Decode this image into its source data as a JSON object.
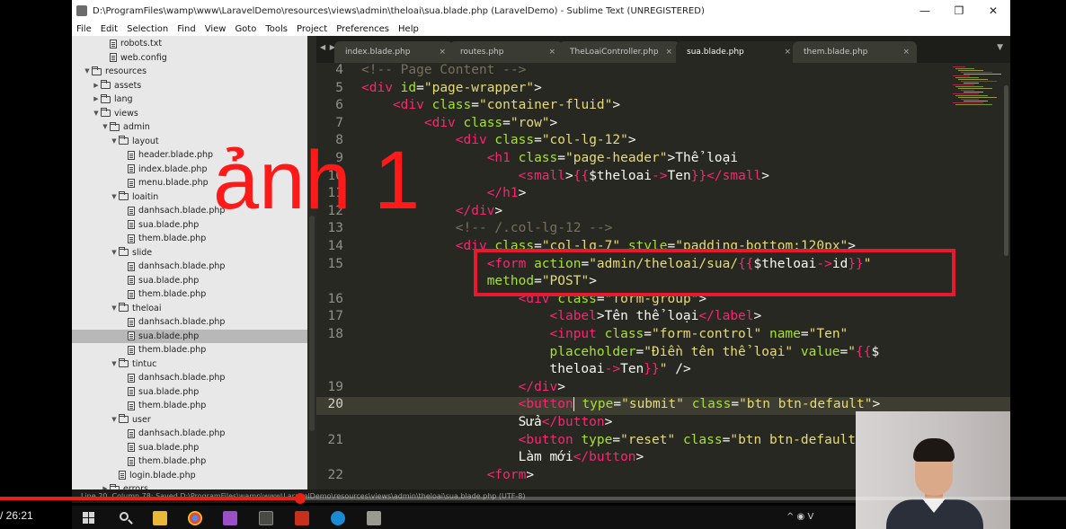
{
  "window": {
    "title": "D:\\ProgramFiles\\wamp\\www\\LaravelDemo\\resources\\views\\admin\\theloai\\sua.blade.php (LaravelDemo) - Sublime Text (UNREGISTERED)",
    "minimize": "—",
    "maximize": "❐",
    "close": "✕"
  },
  "menu": [
    "File",
    "Edit",
    "Selection",
    "Find",
    "View",
    "Goto",
    "Tools",
    "Project",
    "Preferences",
    "Help"
  ],
  "sidebar": {
    "items": [
      {
        "label": "robots.txt",
        "type": "file",
        "depth": 3
      },
      {
        "label": "web.config",
        "type": "file",
        "depth": 3
      },
      {
        "label": "resources",
        "type": "folder",
        "depth": 1,
        "open": true
      },
      {
        "label": "assets",
        "type": "folder",
        "depth": 2,
        "open": false
      },
      {
        "label": "lang",
        "type": "folder",
        "depth": 2,
        "open": false
      },
      {
        "label": "views",
        "type": "folder",
        "depth": 2,
        "open": true
      },
      {
        "label": "admin",
        "type": "folder",
        "depth": 3,
        "open": true
      },
      {
        "label": "layout",
        "type": "folder",
        "depth": 4,
        "open": true
      },
      {
        "label": "header.blade.php",
        "type": "file",
        "depth": 5
      },
      {
        "label": "index.blade.php",
        "type": "file",
        "depth": 5
      },
      {
        "label": "menu.blade.php",
        "type": "file",
        "depth": 5
      },
      {
        "label": "loaitin",
        "type": "folder",
        "depth": 4,
        "open": true
      },
      {
        "label": "danhsach.blade.php",
        "type": "file",
        "depth": 5
      },
      {
        "label": "sua.blade.php",
        "type": "file",
        "depth": 5
      },
      {
        "label": "them.blade.php",
        "type": "file",
        "depth": 5
      },
      {
        "label": "slide",
        "type": "folder",
        "depth": 4,
        "open": true
      },
      {
        "label": "danhsach.blade.php",
        "type": "file",
        "depth": 5
      },
      {
        "label": "sua.blade.php",
        "type": "file",
        "depth": 5
      },
      {
        "label": "them.blade.php",
        "type": "file",
        "depth": 5
      },
      {
        "label": "theloai",
        "type": "folder",
        "depth": 4,
        "open": true
      },
      {
        "label": "danhsach.blade.php",
        "type": "file",
        "depth": 5
      },
      {
        "label": "sua.blade.php",
        "type": "file",
        "depth": 5,
        "selected": true
      },
      {
        "label": "them.blade.php",
        "type": "file",
        "depth": 5
      },
      {
        "label": "tintuc",
        "type": "folder",
        "depth": 4,
        "open": true
      },
      {
        "label": "danhsach.blade.php",
        "type": "file",
        "depth": 5
      },
      {
        "label": "sua.blade.php",
        "type": "file",
        "depth": 5
      },
      {
        "label": "them.blade.php",
        "type": "file",
        "depth": 5
      },
      {
        "label": "user",
        "type": "folder",
        "depth": 4,
        "open": true
      },
      {
        "label": "danhsach.blade.php",
        "type": "file",
        "depth": 5
      },
      {
        "label": "sua.blade.php",
        "type": "file",
        "depth": 5
      },
      {
        "label": "them.blade.php",
        "type": "file",
        "depth": 5
      },
      {
        "label": "login.blade.php",
        "type": "file",
        "depth": 4
      },
      {
        "label": "errors",
        "type": "folder",
        "depth": 3,
        "open": false
      }
    ]
  },
  "tabs": [
    {
      "label": "index.blade.php",
      "active": false
    },
    {
      "label": "routes.php",
      "active": false
    },
    {
      "label": "TheLoaiController.php",
      "active": false
    },
    {
      "label": "sua.blade.php",
      "active": true
    },
    {
      "label": "them.blade.php",
      "active": false
    }
  ],
  "tab_close": "×",
  "tab_arrows": "◀ ▶",
  "tab_dropdown": "▼",
  "editor": {
    "line_numbers": [
      "4",
      "5",
      "6",
      "7",
      "8",
      "9",
      "10",
      "11",
      "12",
      "13",
      "14",
      "15",
      "",
      "16",
      "17",
      "18",
      "",
      "",
      "19",
      "20",
      "",
      "21",
      "",
      "22"
    ],
    "current_line": "20",
    "code": [
      [
        [
          "c",
          "<!-- Page Content -->"
        ]
      ],
      [
        [
          "t",
          "<div "
        ],
        [
          "a",
          "id"
        ],
        [
          "x",
          "="
        ],
        [
          "s",
          "\"page-wrapper\""
        ],
        [
          "x",
          ">"
        ]
      ],
      [
        [
          "x",
          "    "
        ],
        [
          "t",
          "<div "
        ],
        [
          "a",
          "class"
        ],
        [
          "x",
          "="
        ],
        [
          "s",
          "\"container-fluid\""
        ],
        [
          "x",
          ">"
        ]
      ],
      [
        [
          "x",
          "        "
        ],
        [
          "t",
          "<div "
        ],
        [
          "a",
          "class"
        ],
        [
          "x",
          "="
        ],
        [
          "s",
          "\"row\""
        ],
        [
          "x",
          ">"
        ]
      ],
      [
        [
          "x",
          "            "
        ],
        [
          "t",
          "<div "
        ],
        [
          "a",
          "class"
        ],
        [
          "x",
          "="
        ],
        [
          "s",
          "\"col-lg-12\""
        ],
        [
          "x",
          ">"
        ]
      ],
      [
        [
          "x",
          "                "
        ],
        [
          "t",
          "<h1 "
        ],
        [
          "a",
          "class"
        ],
        [
          "x",
          "="
        ],
        [
          "s",
          "\"page-header\""
        ],
        [
          "x",
          ">Thể loại"
        ]
      ],
      [
        [
          "x",
          "                    "
        ],
        [
          "t",
          "<small"
        ],
        [
          "x",
          ">"
        ],
        [
          "p",
          "{{"
        ],
        [
          "x",
          "$theloai"
        ],
        [
          "p",
          "->"
        ],
        [
          "x",
          "Ten"
        ],
        [
          "p",
          "}}"
        ],
        [
          "t",
          "</small"
        ],
        [
          "x",
          ">"
        ]
      ],
      [
        [
          "x",
          "                "
        ],
        [
          "t",
          "</h1"
        ],
        [
          "x",
          ">"
        ]
      ],
      [
        [
          "x",
          "            "
        ],
        [
          "t",
          "</div"
        ],
        [
          "x",
          ">"
        ]
      ],
      [
        [
          "x",
          "            "
        ],
        [
          "c",
          "<!-- /.col-lg-12 -->"
        ]
      ],
      [
        [
          "x",
          "            "
        ],
        [
          "t",
          "<div "
        ],
        [
          "a",
          "class"
        ],
        [
          "x",
          "="
        ],
        [
          "s",
          "\"col-lg-7\" "
        ],
        [
          "a",
          "style"
        ],
        [
          "x",
          "="
        ],
        [
          "s",
          "\"padding-bottom:120px\""
        ],
        [
          "x",
          ">"
        ]
      ],
      [
        [
          "x",
          "                "
        ],
        [
          "t",
          "<form "
        ],
        [
          "a",
          "action"
        ],
        [
          "x",
          "="
        ],
        [
          "s",
          "\"admin/theloai/sua/"
        ],
        [
          "p",
          "{{"
        ],
        [
          "x",
          "$theloai"
        ],
        [
          "p",
          "->"
        ],
        [
          "x",
          "id"
        ],
        [
          "p",
          "}}"
        ],
        [
          "s",
          "\""
        ]
      ],
      [
        [
          "x",
          "                "
        ],
        [
          "a",
          "method"
        ],
        [
          "x",
          "="
        ],
        [
          "s",
          "\"POST\""
        ],
        [
          "x",
          ">"
        ]
      ],
      [
        [
          "x",
          "                    "
        ],
        [
          "t",
          "<div "
        ],
        [
          "a",
          "class"
        ],
        [
          "x",
          "="
        ],
        [
          "s",
          "\"form-group\""
        ],
        [
          "x",
          ">"
        ]
      ],
      [
        [
          "x",
          "                        "
        ],
        [
          "t",
          "<label"
        ],
        [
          "x",
          ">Tên thể loại"
        ],
        [
          "t",
          "</label"
        ],
        [
          "x",
          ">"
        ]
      ],
      [
        [
          "x",
          "                        "
        ],
        [
          "t",
          "<input "
        ],
        [
          "a",
          "class"
        ],
        [
          "x",
          "="
        ],
        [
          "s",
          "\"form-control\" "
        ],
        [
          "a",
          "name"
        ],
        [
          "x",
          "="
        ],
        [
          "s",
          "\"Ten\""
        ]
      ],
      [
        [
          "x",
          "                        "
        ],
        [
          "a",
          "placeholder"
        ],
        [
          "x",
          "="
        ],
        [
          "s",
          "\"Điền tên thể loại\" "
        ],
        [
          "a",
          "value"
        ],
        [
          "x",
          "="
        ],
        [
          "s",
          "\""
        ],
        [
          "p",
          "{{"
        ],
        [
          "x",
          "$"
        ]
      ],
      [
        [
          "x",
          "                        "
        ],
        [
          "x",
          "theloai"
        ],
        [
          "p",
          "->"
        ],
        [
          "x",
          "Ten"
        ],
        [
          "p",
          "}}"
        ],
        [
          "s",
          "\""
        ],
        [
          "x",
          " />"
        ]
      ],
      [
        [
          "x",
          "                    "
        ],
        [
          "t",
          "</div"
        ],
        [
          "x",
          ">"
        ]
      ],
      [
        [
          "x",
          "                    "
        ],
        [
          "t",
          "<button"
        ],
        [
          "k",
          ""
        ],
        [
          "x",
          " "
        ],
        [
          "a",
          "type"
        ],
        [
          "x",
          "="
        ],
        [
          "s",
          "\"submit\" "
        ],
        [
          "a",
          "class"
        ],
        [
          "x",
          "="
        ],
        [
          "s",
          "\"btn btn-default\""
        ],
        [
          "x",
          ">"
        ]
      ],
      [
        [
          "x",
          "                    Sửa"
        ],
        [
          "t",
          "</button"
        ],
        [
          "x",
          ">"
        ]
      ],
      [
        [
          "x",
          "                    "
        ],
        [
          "t",
          "<button "
        ],
        [
          "a",
          "type"
        ],
        [
          "x",
          "="
        ],
        [
          "s",
          "\"reset\" "
        ],
        [
          "a",
          "class"
        ],
        [
          "x",
          "="
        ],
        [
          "s",
          "\"btn btn-default\""
        ],
        [
          "x",
          ">"
        ]
      ],
      [
        [
          "x",
          "                    Làm mới"
        ],
        [
          "t",
          "</button"
        ],
        [
          "x",
          ">"
        ]
      ],
      [
        [
          "x",
          "                "
        ],
        [
          "t",
          "<form"
        ],
        [
          "x",
          ">"
        ]
      ]
    ]
  },
  "statusbar": "Line 20, Column 78; Saved D:\\ProgramFiles\\wamp\\www\\LaravelDemo\\resources\\views\\admin\\theloai\\sua.blade.php (UTF-8)",
  "annotation": {
    "label": "ảnh 1",
    "color": "#ff1a1a"
  },
  "video": {
    "time": "/ 26:21",
    "progress": 0.282
  },
  "colors": {
    "editor_bg": "#272822",
    "tag": "#f92672",
    "attr": "#a6e22e",
    "string": "#e6db74",
    "comment": "#75715e",
    "highlight_box": "#e6192e",
    "progress": "#e62117"
  },
  "taskbar_icons": [
    "windows-start-icon",
    "search-icon",
    "file-explorer-icon",
    "chrome-icon",
    "app-icon",
    "sublime-icon",
    "filezilla-icon",
    "skype-icon",
    "app-icon"
  ],
  "tray": "^ ◉ V"
}
